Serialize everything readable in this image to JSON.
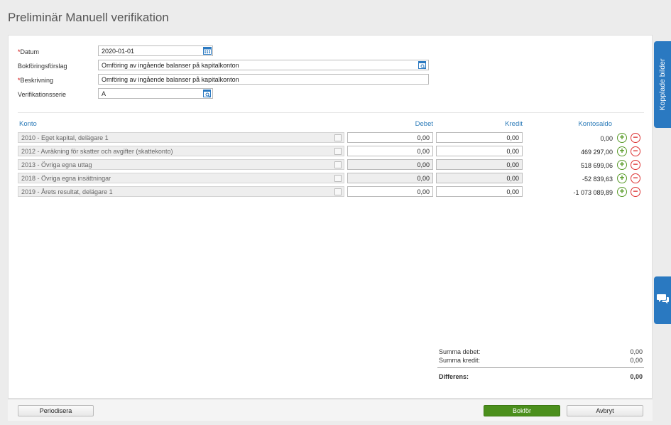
{
  "page": {
    "title": "Preliminär Manuell verifikation"
  },
  "form": {
    "datum_label": "Datum",
    "datum_value": "2020-01-01",
    "bokforingsforslag_label": "Bokföringsförslag",
    "bokforingsforslag_value": "Omföring av ingående balanser på kapitalkonton",
    "beskrivning_label": "Beskrivning",
    "beskrivning_value": "Omföring av ingående balanser på kapitalkonton",
    "serie_label": "Verifikationsserie",
    "serie_value": "A",
    "required_mark": "*"
  },
  "table": {
    "headers": {
      "konto": "Konto",
      "debet": "Debet",
      "kredit": "Kredit",
      "saldo": "Kontosaldo"
    },
    "rows": [
      {
        "konto": "2010 - Eget kapital, delägare 1",
        "debet": "0,00",
        "kredit": "0,00",
        "saldo": "0,00"
      },
      {
        "konto": "2012 - Avräkning för skatter och avgifter (skattekonto)",
        "debet": "0,00",
        "kredit": "0,00",
        "saldo": "469 297,00"
      },
      {
        "konto": "2013 - Övriga egna uttag",
        "debet": "0,00",
        "kredit": "0,00",
        "saldo": "518 699,06"
      },
      {
        "konto": "2018 - Övriga egna insättningar",
        "debet": "0,00",
        "kredit": "0,00",
        "saldo": "-52 839,63"
      },
      {
        "konto": "2019 - Årets resultat, delägare 1",
        "debet": "0,00",
        "kredit": "0,00",
        "saldo": "-1 073 089,89"
      }
    ],
    "add_symbol": "+",
    "remove_symbol": "−"
  },
  "summary": {
    "summa_debet_label": "Summa debet:",
    "summa_debet_value": "0,00",
    "summa_kredit_label": "Summa kredit:",
    "summa_kredit_value": "0,00",
    "differens_label": "Differens:",
    "differens_value": "0,00"
  },
  "footer": {
    "periodisera": "Periodisera",
    "bokfor": "Bokför",
    "avbryt": "Avbryt"
  },
  "side": {
    "kopplade_bilder": "Kopplade bilder",
    "chat_icon": "chat-icon"
  },
  "colors": {
    "accent": "#2a79c1",
    "primary_button": "#4b8f1c",
    "add": "#5a9c2a",
    "remove": "#dd3333"
  }
}
